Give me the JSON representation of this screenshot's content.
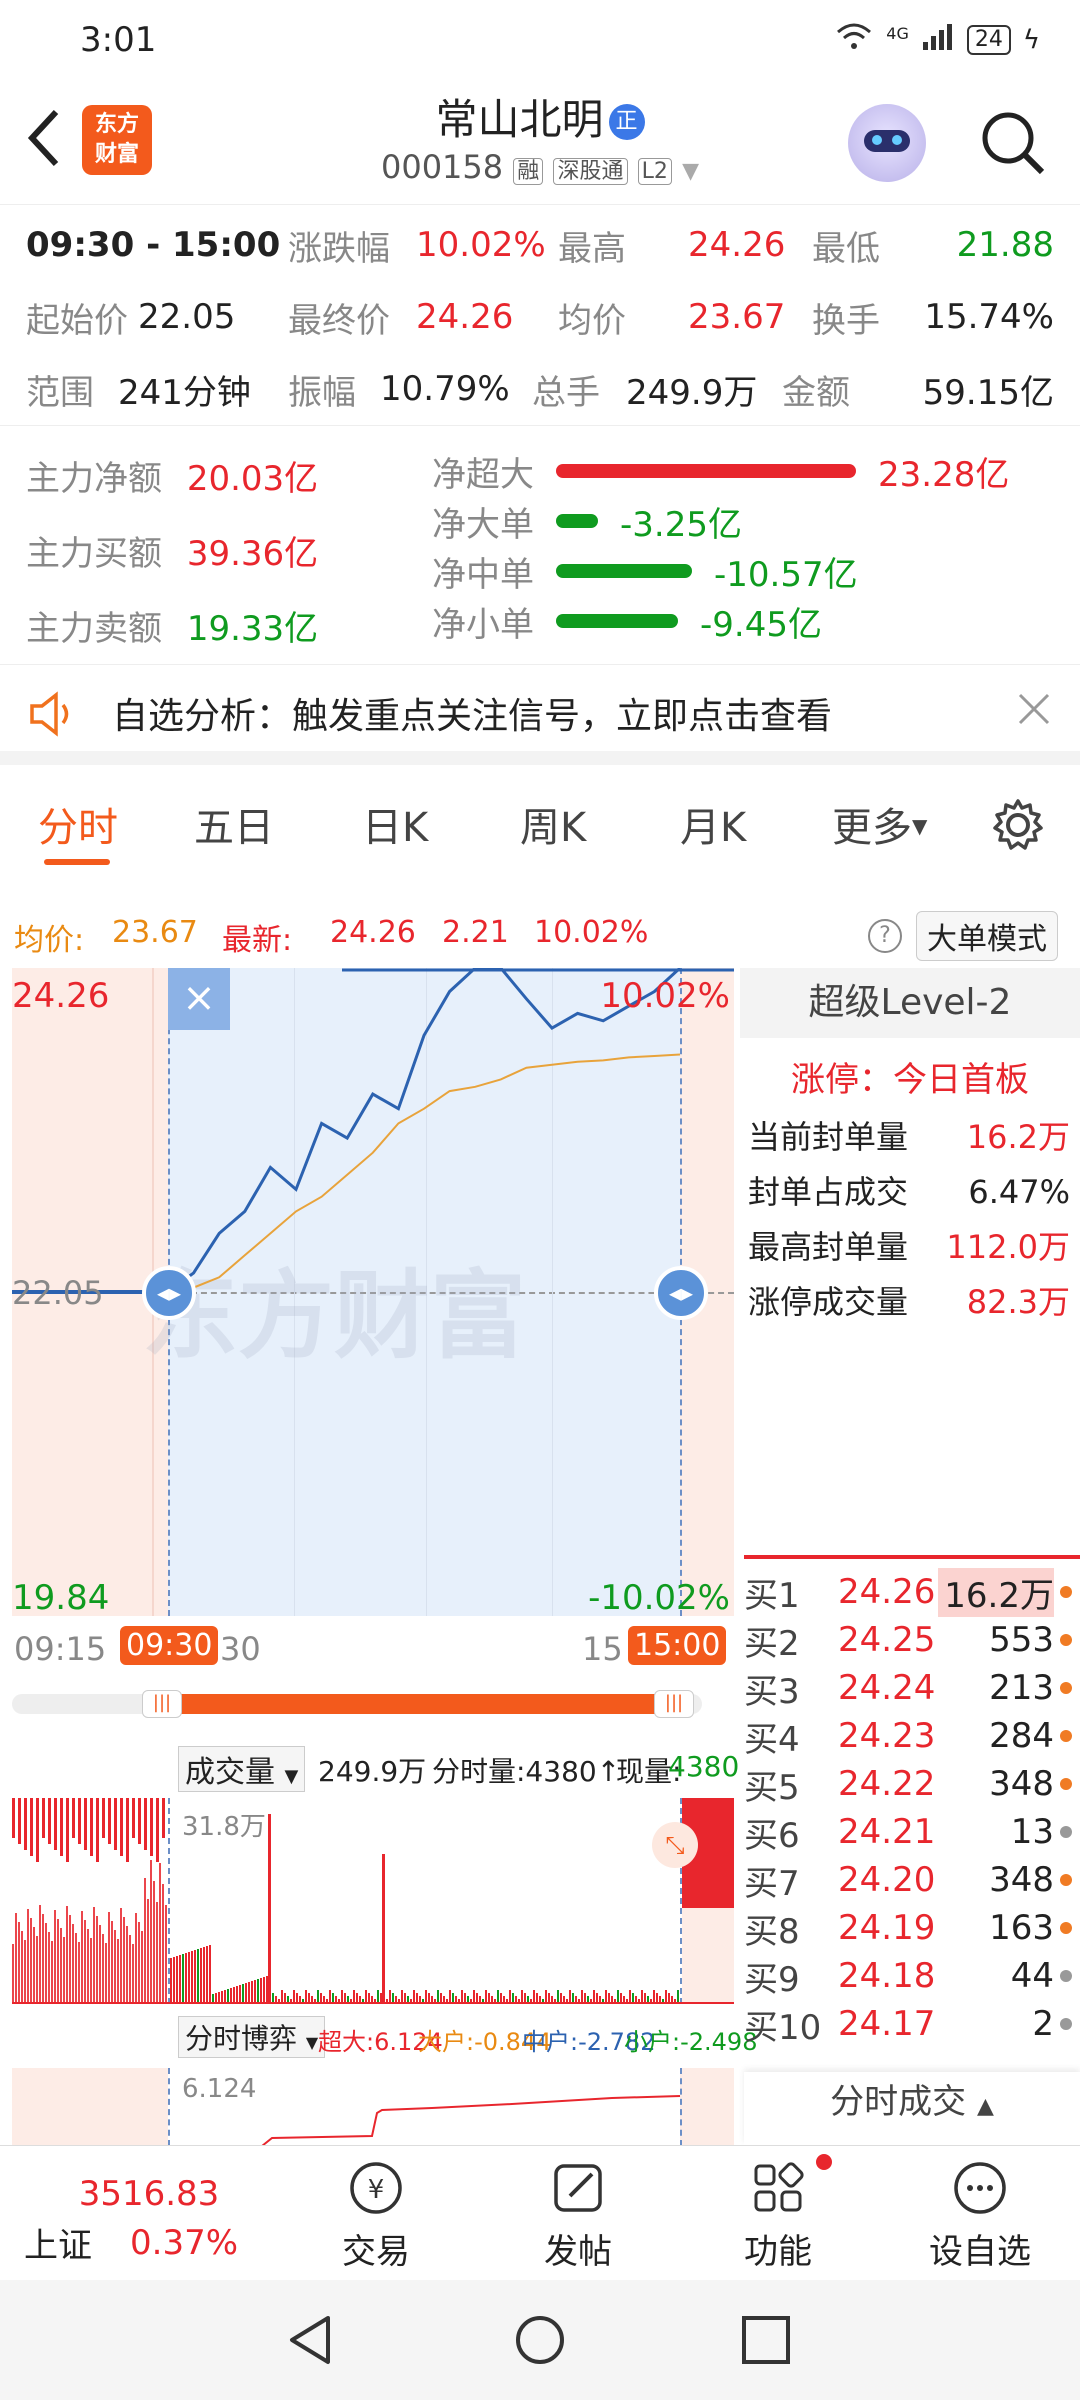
{
  "status": {
    "time": "3:01",
    "net": "4G",
    "battery": "24"
  },
  "header": {
    "logo_line1": "东方",
    "logo_line2": "财富",
    "stock_name": "常山北明",
    "stock_badge": "正",
    "stock_code": "000158",
    "tags": [
      "融",
      "深股通",
      "L2"
    ]
  },
  "stats": {
    "rows": [
      [
        {
          "label": "09:30 - 15:00",
          "value": ""
        },
        {
          "label": "涨跌幅",
          "value": "10.02%"
        },
        {
          "label": "最高",
          "value": "24.26"
        },
        {
          "label": "最低",
          "value": "21.88"
        }
      ],
      [
        {
          "label": "起始价",
          "value": "22.05"
        },
        {
          "label": "最终价",
          "value": "24.26"
        },
        {
          "label": "均价",
          "value": "23.67"
        },
        {
          "label": "换手",
          "value": "15.74%"
        }
      ],
      [
        {
          "label": "范围",
          "value": "241分钟"
        },
        {
          "label": "振幅",
          "value": "10.79%"
        },
        {
          "label": "总手",
          "value": "249.9万"
        },
        {
          "label": "金额",
          "value": "59.15亿"
        }
      ]
    ]
  },
  "flow": {
    "left": [
      {
        "label": "主力净额",
        "value": "20.03亿"
      },
      {
        "label": "主力买额",
        "value": "39.36亿"
      },
      {
        "label": "主力卖额",
        "value": "19.33亿"
      }
    ],
    "right": [
      {
        "label": "净超大",
        "value": "23.28亿",
        "amount": 23.28
      },
      {
        "label": "净大单",
        "value": "-3.25亿",
        "amount": -3.25
      },
      {
        "label": "净中单",
        "value": "-10.57亿",
        "amount": -10.57
      },
      {
        "label": "净小单",
        "value": "-9.45亿",
        "amount": -9.45
      }
    ]
  },
  "banner": {
    "text": "自选分析：触发重点关注信号，立即点击查看"
  },
  "tabs": [
    "分时",
    "五日",
    "日K",
    "周K",
    "月K",
    "更多"
  ],
  "summary": {
    "avg_label": "均价:",
    "avg_value": "23.67",
    "latest_label": "最新:",
    "latest_value": "24.26",
    "change": "2.21",
    "pct": "10.02%",
    "mode_button": "大单模式"
  },
  "chart": {
    "top_price": "24.26",
    "top_pct": "10.02%",
    "mid_price": "22.05",
    "bottom_price": "19.84",
    "bottom_pct": "-10.02%",
    "watermark": "东方财富",
    "time_start": "09:15",
    "time_sel_start": "09:30",
    "time_mid": "30",
    "time_end_partial": "15",
    "time_sel_end": "15:00"
  },
  "chart_data": {
    "type": "line",
    "ylim": [
      19.84,
      24.26
    ],
    "series": [
      {
        "name": "价格",
        "values": [
          22.05,
          22.18,
          22.45,
          22.6,
          22.9,
          22.75,
          23.2,
          23.1,
          23.4,
          23.3,
          23.8,
          24.1,
          24.26,
          24.26,
          24.05,
          23.85,
          23.95,
          23.9,
          24.0,
          24.1,
          24.26
        ]
      },
      {
        "name": "均价",
        "values": [
          22.05,
          22.08,
          22.15,
          22.3,
          22.45,
          22.6,
          22.7,
          22.85,
          23.0,
          23.2,
          23.3,
          23.42,
          23.45,
          23.5,
          23.58,
          23.6,
          23.62,
          23.63,
          23.65,
          23.66,
          23.67
        ]
      }
    ]
  },
  "level2": {
    "title": "超级Level-2",
    "limit_status": "涨停：今日首板",
    "items": [
      {
        "label": "当前封单量",
        "value": "16.2万"
      },
      {
        "label": "封单占成交",
        "value": "6.47%"
      },
      {
        "label": "最高封单量",
        "value": "112.0万"
      },
      {
        "label": "涨停成交量",
        "value": "82.3万"
      }
    ]
  },
  "book": [
    {
      "label": "买1",
      "price": "24.26",
      "vol": "16.2万"
    },
    {
      "label": "买2",
      "price": "24.25",
      "vol": "553"
    },
    {
      "label": "买3",
      "price": "24.24",
      "vol": "213"
    },
    {
      "label": "买4",
      "price": "24.23",
      "vol": "284"
    },
    {
      "label": "买5",
      "price": "24.22",
      "vol": "348"
    },
    {
      "label": "买6",
      "price": "24.21",
      "vol": "13"
    },
    {
      "label": "买7",
      "price": "24.20",
      "vol": "348"
    },
    {
      "label": "买8",
      "price": "24.19",
      "vol": "163"
    },
    {
      "label": "买9",
      "price": "24.18",
      "vol": "44"
    },
    {
      "label": "买10",
      "price": "24.17",
      "vol": "2"
    }
  ],
  "volume": {
    "selector": "成交量",
    "total": "249.9万",
    "fenshi": "分时量:4380↑",
    "now_label": "现量:",
    "now_value": "4380",
    "max_label": "31.8万"
  },
  "boyi": {
    "selector": "分时博弈",
    "chao_label": "超大:",
    "chao": "6.124",
    "da_label": "大户:",
    "da": "-0.844",
    "zhong_label": "中户:",
    "zhong": "-2.782",
    "xiao_label": "小户:",
    "xiao": "-2.498",
    "max_label": "6.124"
  },
  "fenshi_trade": {
    "label": "分时成交"
  },
  "bottom": {
    "index_value": "3516.83",
    "index_name": "上证",
    "index_pct": "0.37%",
    "nav": [
      "交易",
      "发帖",
      "功能",
      "设自选"
    ]
  }
}
